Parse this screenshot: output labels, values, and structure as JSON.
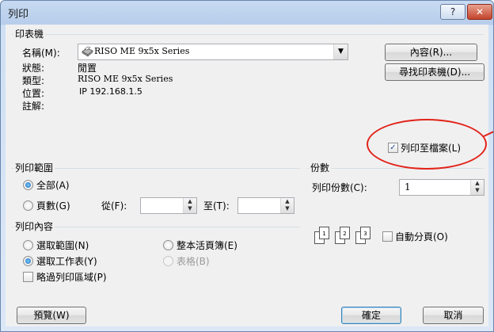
{
  "window": {
    "title": "列印",
    "help_label": "?",
    "close_label": "✕"
  },
  "printer": {
    "group_title": "印表機",
    "name_label": "名稱(M):",
    "name_value": "RISO ME 9x5x Series",
    "status_label": "狀態:",
    "status_value": "閒置",
    "type_label": "類型:",
    "type_value": "RISO ME 9x5x Series",
    "location_label": "位置:",
    "location_value": "IP 192.168.1.5",
    "comment_label": "註解:",
    "properties_button": "內容(R)...",
    "find_printer_button": "尋找印表機(D)...",
    "print_to_file_label": "列印至檔案(L)",
    "print_to_file_checked": true,
    "printer_icon": "printer-icon",
    "dropdown_icon": "chevron-down-icon"
  },
  "range": {
    "group_title": "列印範圍",
    "all_label": "全部(A)",
    "all_selected": true,
    "pages_label": "頁數(G)",
    "from_label": "從(F):",
    "from_value": "",
    "to_label": "至(T):",
    "to_value": ""
  },
  "copies": {
    "group_title": "份數",
    "count_label": "列印份數(C):",
    "count_value": "1",
    "collate_label": "自動分頁(O)",
    "collate_checked": false,
    "collate_icon": "collate-pages-icon"
  },
  "content": {
    "group_title": "列印內容",
    "selection_label": "選取範圍(N)",
    "entire_workbook_label": "整本活頁簿(E)",
    "active_sheets_label": "選取工作表(Y)",
    "active_sheets_selected": true,
    "table_label": "表格(B)",
    "ignore_print_areas_label": "略過列印區域(P)"
  },
  "footer": {
    "preview_button": "預覽(W)",
    "ok_button": "確定",
    "cancel_button": "取消"
  },
  "colors": {
    "highlight": "#e2231a",
    "title_bar": "#c7daf2",
    "close_button": "#c4432b"
  }
}
